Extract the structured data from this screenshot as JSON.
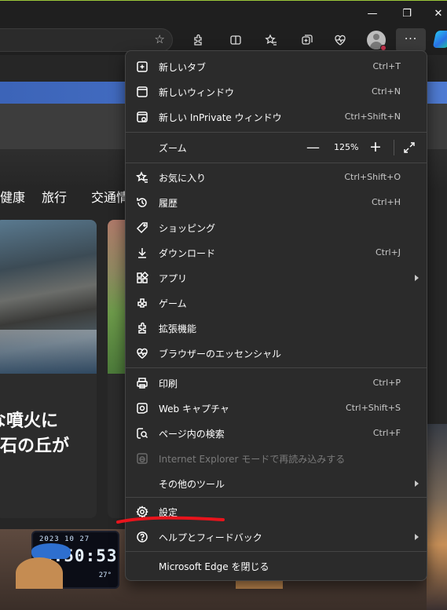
{
  "window": {
    "minimize_glyph": "—",
    "maximize_glyph": "❐",
    "close_glyph": "✕"
  },
  "toolbar": {
    "more_glyph": "···",
    "icons": [
      "favorite-star-icon",
      "extensions-icon",
      "split-screen-icon",
      "favorites-icon",
      "collections-icon",
      "browser-essentials-icon",
      "profile-avatar",
      "settings-and-more-icon",
      "copilot-icon"
    ]
  },
  "page": {
    "nav": [
      "健康",
      "旅行",
      "交通情"
    ],
    "headline_lines": [
      "な噴火に",
      "石の丘が"
    ],
    "clock": {
      "date": "2023  10  27",
      "time": "6:50:53",
      "day": "27°"
    }
  },
  "menu": {
    "new_tab": {
      "label": "新しいタブ",
      "shortcut": "Ctrl+T",
      "icon": "new-tab-icon"
    },
    "new_window": {
      "label": "新しいウィンドウ",
      "shortcut": "Ctrl+N",
      "icon": "new-window-icon"
    },
    "new_inprivate": {
      "label": "新しい InPrivate ウィンドウ",
      "shortcut": "Ctrl+Shift+N",
      "icon": "inprivate-icon"
    },
    "zoom": {
      "label": "ズーム",
      "minus": "—",
      "value": "125%",
      "plus": "+",
      "icon": "fullscreen-icon"
    },
    "favorites": {
      "label": "お気に入り",
      "shortcut": "Ctrl+Shift+O",
      "icon": "favorites-icon"
    },
    "history": {
      "label": "履歴",
      "shortcut": "Ctrl+H",
      "icon": "history-icon"
    },
    "shopping": {
      "label": "ショッピング",
      "icon": "shopping-tag-icon"
    },
    "downloads": {
      "label": "ダウンロード",
      "shortcut": "Ctrl+J",
      "icon": "download-icon"
    },
    "apps": {
      "label": "アプリ",
      "icon": "apps-icon"
    },
    "games": {
      "label": "ゲーム",
      "icon": "games-icon"
    },
    "extensions": {
      "label": "拡張機能",
      "icon": "extensions-icon"
    },
    "essentials": {
      "label": "ブラウザーのエッセンシャル",
      "icon": "browser-essentials-icon"
    },
    "print": {
      "label": "印刷",
      "shortcut": "Ctrl+P",
      "icon": "print-icon"
    },
    "web_capture": {
      "label": "Web キャプチャ",
      "shortcut": "Ctrl+Shift+S",
      "icon": "web-capture-icon"
    },
    "find": {
      "label": "ページ内の検索",
      "shortcut": "Ctrl+F",
      "icon": "find-icon"
    },
    "ie_mode": {
      "label": "Internet Explorer モードで再読み込みする",
      "icon": "ie-mode-icon",
      "disabled": true
    },
    "more_tools": {
      "label": "その他のツール"
    },
    "settings": {
      "label": "設定",
      "icon": "settings-gear-icon"
    },
    "help": {
      "label": "ヘルプとフィードバック",
      "icon": "help-icon"
    },
    "close_edge": {
      "label": "Microsoft Edge を閉じる"
    }
  },
  "colors": {
    "menu_bg": "#2b2b2b",
    "annotation_red": "#e8141c"
  }
}
